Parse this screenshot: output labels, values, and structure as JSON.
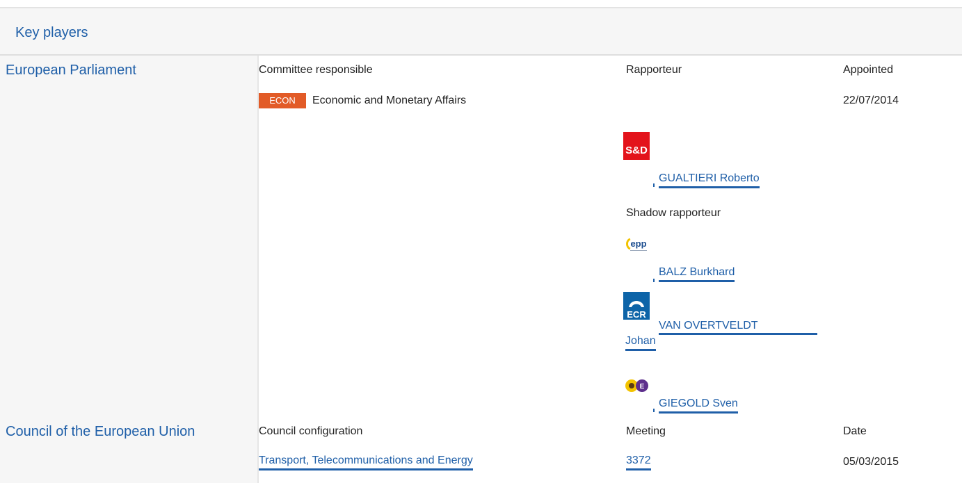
{
  "section": {
    "title": "Key players"
  },
  "parliament": {
    "name": "European Parliament",
    "headers": {
      "committee": "Committee responsible",
      "rapporteur": "Rapporteur",
      "appointed": "Appointed"
    },
    "committee": {
      "code": "ECON",
      "name": "Economic and Monetary Affairs",
      "appointed_date": "22/07/2014"
    },
    "rapporteur": {
      "group_logo": "sd-logo",
      "name": "GUALTIERI Roberto"
    },
    "shadow_label": "Shadow rapporteur",
    "shadows": [
      {
        "group_logo": "epp-logo",
        "name": "BALZ Burkhard"
      },
      {
        "group_logo": "ecr-logo",
        "name_line1": "VAN OVERTVELDT",
        "name_line2": "Johan"
      },
      {
        "group_logo": "greens-efa-logo",
        "name": "GIEGOLD Sven"
      }
    ],
    "colors": {
      "badge": "#e25b27",
      "sd": "#e3131b",
      "ecr": "#0d64a8",
      "link": "#1f5fa8"
    }
  },
  "council": {
    "name": "Council of the European Union",
    "headers": {
      "configuration": "Council configuration",
      "meeting": "Meeting",
      "date": "Date"
    },
    "row": {
      "configuration": "Transport, Telecommunications and Energy",
      "meeting": "3372",
      "date": "05/03/2015"
    }
  }
}
